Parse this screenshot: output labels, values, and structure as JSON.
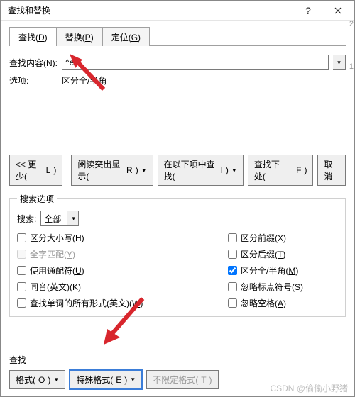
{
  "titlebar": {
    "title": "查找和替换"
  },
  "tabs": [
    {
      "label_pre": "查找(",
      "key": "D",
      "label_post": ")"
    },
    {
      "label_pre": "替换(",
      "key": "P",
      "label_post": ")"
    },
    {
      "label_pre": "定位(",
      "key": "G",
      "label_post": ")"
    }
  ],
  "find": {
    "label_pre": "查找内容(",
    "key": "N",
    "label_post": "):",
    "value": "^e"
  },
  "options_row": {
    "label": "选项:",
    "value": "区分全/半角"
  },
  "main_buttons": {
    "less_pre": "<<  更少(",
    "less_key": "L",
    "less_post": ")",
    "highlight_pre": "阅读突出显示(",
    "highlight_key": "R",
    "highlight_post": ")",
    "findin_pre": "在以下项中查找(",
    "findin_key": "I",
    "findin_post": ")",
    "findnext_pre": "查找下一处(",
    "findnext_key": "F",
    "findnext_post": ")",
    "cancel": "取消"
  },
  "search_options": {
    "legend": "搜索选项",
    "search_label": "搜索:",
    "search_value": "全部",
    "left": [
      {
        "pre": "区分大小写(",
        "key": "H",
        "post": ")",
        "checked": false,
        "disabled": false
      },
      {
        "pre": "全字匹配(",
        "key": "Y",
        "post": ")",
        "checked": false,
        "disabled": true
      },
      {
        "pre": "使用通配符(",
        "key": "U",
        "post": ")",
        "checked": false,
        "disabled": false
      },
      {
        "pre": "同音(英文)(",
        "key": "K",
        "post": ")",
        "checked": false,
        "disabled": false
      },
      {
        "pre": "查找单词的所有形式(英文)(",
        "key": "W",
        "post": ")",
        "checked": false,
        "disabled": false
      }
    ],
    "right": [
      {
        "pre": "区分前缀(",
        "key": "X",
        "post": ")",
        "checked": false
      },
      {
        "pre": "区分后缀(",
        "key": "T",
        "post": ")",
        "checked": false
      },
      {
        "pre": "区分全/半角(",
        "key": "M",
        "post": ")",
        "checked": true
      },
      {
        "pre": "忽略标点符号(",
        "key": "S",
        "post": ")",
        "checked": false
      },
      {
        "pre": "忽略空格(",
        "key": "A",
        "post": ")",
        "checked": false
      }
    ]
  },
  "find_format": {
    "section": "查找",
    "format_pre": "格式(",
    "format_key": "O",
    "format_post": ")",
    "special_pre": "特殊格式(",
    "special_key": "E",
    "special_post": ")",
    "noformat_pre": "不限定格式(",
    "noformat_key": "T",
    "noformat_post": ")"
  },
  "watermark": "CSDN @偷偷小野猪",
  "side": {
    "a": "2",
    "b": "1"
  }
}
